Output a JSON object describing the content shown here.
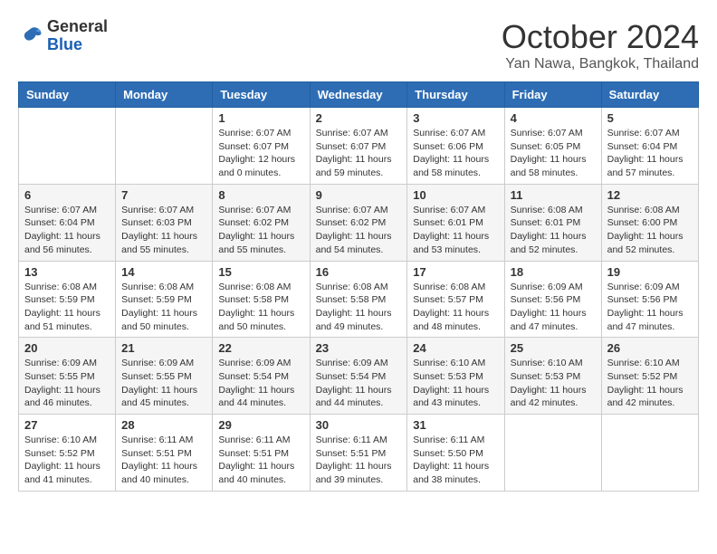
{
  "header": {
    "logo_general": "General",
    "logo_blue": "Blue",
    "month": "October 2024",
    "location": "Yan Nawa, Bangkok, Thailand"
  },
  "weekdays": [
    "Sunday",
    "Monday",
    "Tuesday",
    "Wednesday",
    "Thursday",
    "Friday",
    "Saturday"
  ],
  "weeks": [
    [
      {
        "day": "",
        "info": ""
      },
      {
        "day": "",
        "info": ""
      },
      {
        "day": "1",
        "info": "Sunrise: 6:07 AM\nSunset: 6:07 PM\nDaylight: 12 hours\nand 0 minutes."
      },
      {
        "day": "2",
        "info": "Sunrise: 6:07 AM\nSunset: 6:07 PM\nDaylight: 11 hours\nand 59 minutes."
      },
      {
        "day": "3",
        "info": "Sunrise: 6:07 AM\nSunset: 6:06 PM\nDaylight: 11 hours\nand 58 minutes."
      },
      {
        "day": "4",
        "info": "Sunrise: 6:07 AM\nSunset: 6:05 PM\nDaylight: 11 hours\nand 58 minutes."
      },
      {
        "day": "5",
        "info": "Sunrise: 6:07 AM\nSunset: 6:04 PM\nDaylight: 11 hours\nand 57 minutes."
      }
    ],
    [
      {
        "day": "6",
        "info": "Sunrise: 6:07 AM\nSunset: 6:04 PM\nDaylight: 11 hours\nand 56 minutes."
      },
      {
        "day": "7",
        "info": "Sunrise: 6:07 AM\nSunset: 6:03 PM\nDaylight: 11 hours\nand 55 minutes."
      },
      {
        "day": "8",
        "info": "Sunrise: 6:07 AM\nSunset: 6:02 PM\nDaylight: 11 hours\nand 55 minutes."
      },
      {
        "day": "9",
        "info": "Sunrise: 6:07 AM\nSunset: 6:02 PM\nDaylight: 11 hours\nand 54 minutes."
      },
      {
        "day": "10",
        "info": "Sunrise: 6:07 AM\nSunset: 6:01 PM\nDaylight: 11 hours\nand 53 minutes."
      },
      {
        "day": "11",
        "info": "Sunrise: 6:08 AM\nSunset: 6:01 PM\nDaylight: 11 hours\nand 52 minutes."
      },
      {
        "day": "12",
        "info": "Sunrise: 6:08 AM\nSunset: 6:00 PM\nDaylight: 11 hours\nand 52 minutes."
      }
    ],
    [
      {
        "day": "13",
        "info": "Sunrise: 6:08 AM\nSunset: 5:59 PM\nDaylight: 11 hours\nand 51 minutes."
      },
      {
        "day": "14",
        "info": "Sunrise: 6:08 AM\nSunset: 5:59 PM\nDaylight: 11 hours\nand 50 minutes."
      },
      {
        "day": "15",
        "info": "Sunrise: 6:08 AM\nSunset: 5:58 PM\nDaylight: 11 hours\nand 50 minutes."
      },
      {
        "day": "16",
        "info": "Sunrise: 6:08 AM\nSunset: 5:58 PM\nDaylight: 11 hours\nand 49 minutes."
      },
      {
        "day": "17",
        "info": "Sunrise: 6:08 AM\nSunset: 5:57 PM\nDaylight: 11 hours\nand 48 minutes."
      },
      {
        "day": "18",
        "info": "Sunrise: 6:09 AM\nSunset: 5:56 PM\nDaylight: 11 hours\nand 47 minutes."
      },
      {
        "day": "19",
        "info": "Sunrise: 6:09 AM\nSunset: 5:56 PM\nDaylight: 11 hours\nand 47 minutes."
      }
    ],
    [
      {
        "day": "20",
        "info": "Sunrise: 6:09 AM\nSunset: 5:55 PM\nDaylight: 11 hours\nand 46 minutes."
      },
      {
        "day": "21",
        "info": "Sunrise: 6:09 AM\nSunset: 5:55 PM\nDaylight: 11 hours\nand 45 minutes."
      },
      {
        "day": "22",
        "info": "Sunrise: 6:09 AM\nSunset: 5:54 PM\nDaylight: 11 hours\nand 44 minutes."
      },
      {
        "day": "23",
        "info": "Sunrise: 6:09 AM\nSunset: 5:54 PM\nDaylight: 11 hours\nand 44 minutes."
      },
      {
        "day": "24",
        "info": "Sunrise: 6:10 AM\nSunset: 5:53 PM\nDaylight: 11 hours\nand 43 minutes."
      },
      {
        "day": "25",
        "info": "Sunrise: 6:10 AM\nSunset: 5:53 PM\nDaylight: 11 hours\nand 42 minutes."
      },
      {
        "day": "26",
        "info": "Sunrise: 6:10 AM\nSunset: 5:52 PM\nDaylight: 11 hours\nand 42 minutes."
      }
    ],
    [
      {
        "day": "27",
        "info": "Sunrise: 6:10 AM\nSunset: 5:52 PM\nDaylight: 11 hours\nand 41 minutes."
      },
      {
        "day": "28",
        "info": "Sunrise: 6:11 AM\nSunset: 5:51 PM\nDaylight: 11 hours\nand 40 minutes."
      },
      {
        "day": "29",
        "info": "Sunrise: 6:11 AM\nSunset: 5:51 PM\nDaylight: 11 hours\nand 40 minutes."
      },
      {
        "day": "30",
        "info": "Sunrise: 6:11 AM\nSunset: 5:51 PM\nDaylight: 11 hours\nand 39 minutes."
      },
      {
        "day": "31",
        "info": "Sunrise: 6:11 AM\nSunset: 5:50 PM\nDaylight: 11 hours\nand 38 minutes."
      },
      {
        "day": "",
        "info": ""
      },
      {
        "day": "",
        "info": ""
      }
    ]
  ]
}
